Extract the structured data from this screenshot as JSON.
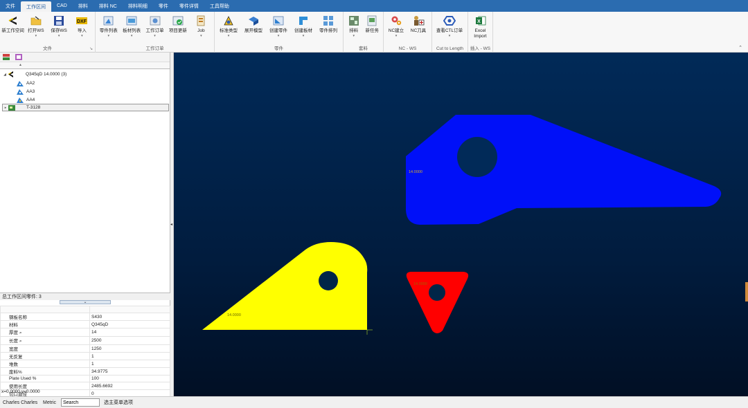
{
  "menu": {
    "tabs": [
      "文件",
      "工作区间",
      "CAD",
      "排料",
      "排料 NC",
      "排料明细",
      "零件",
      "零件详情",
      "工具帮助"
    ],
    "active_index": 1
  },
  "ribbon": {
    "groups": [
      {
        "name": "文件",
        "buttons": [
          {
            "label": "新工作空间",
            "icon": "new-workspace-icon",
            "dropdown": false
          },
          {
            "label": "打开WS",
            "icon": "open-folder-icon",
            "dropdown": true
          },
          {
            "label": "保存WS",
            "icon": "save-disk-icon",
            "dropdown": true
          },
          {
            "label": "导入",
            "icon": "dxf-import-icon",
            "dropdown": true
          }
        ]
      },
      {
        "name": "工作订单",
        "buttons": [
          {
            "label": "零件列表",
            "icon": "parts-list-icon",
            "dropdown": true
          },
          {
            "label": "板材列表",
            "icon": "plates-list-icon",
            "dropdown": true
          },
          {
            "label": "工作订单",
            "icon": "work-order-icon",
            "dropdown": true
          },
          {
            "label": "项目更新",
            "icon": "project-update-icon",
            "dropdown": false
          },
          {
            "label": "Job",
            "icon": "job-icon",
            "dropdown": true
          }
        ]
      },
      {
        "name": "零件",
        "buttons": [
          {
            "label": "标准类型",
            "icon": "standard-shape-icon",
            "dropdown": true
          },
          {
            "label": "展开模型",
            "icon": "unfold-model-icon",
            "dropdown": false
          },
          {
            "label": "创建零件",
            "icon": "create-part-icon",
            "dropdown": true
          },
          {
            "label": "创建板材",
            "icon": "create-plate-icon",
            "dropdown": true
          },
          {
            "label": "零件排列",
            "icon": "part-array-icon",
            "dropdown": false
          }
        ]
      },
      {
        "name": "套料",
        "buttons": [
          {
            "label": "排料",
            "icon": "nest-icon",
            "dropdown": true
          },
          {
            "label": "新任务",
            "icon": "new-task-icon",
            "dropdown": false
          }
        ]
      },
      {
        "name": "NC - WS",
        "buttons": [
          {
            "label": "NC建立",
            "icon": "nc-build-icon",
            "dropdown": true
          },
          {
            "label": "NC刀具",
            "icon": "nc-tool-icon",
            "dropdown": false
          }
        ]
      },
      {
        "name": "Cut to Length",
        "buttons": [
          {
            "label": "查看CTL订单",
            "icon": "ctl-order-icon",
            "dropdown": true
          }
        ]
      },
      {
        "name": "插入 - WS",
        "buttons": [
          {
            "label": "Excel Import",
            "icon": "excel-import-icon",
            "dropdown": false
          }
        ]
      }
    ],
    "colors": {
      "accent": "#2b6cb0"
    }
  },
  "tree": {
    "nodes": [
      {
        "label": "Q345qD 14.0000 (3)",
        "icon": "plate-group-icon",
        "level": 0,
        "expanded": true
      },
      {
        "label": "AA2",
        "icon": "part-icon",
        "level": 1
      },
      {
        "label": "AA3",
        "icon": "part-icon",
        "level": 1
      },
      {
        "label": "AA4",
        "icon": "part-icon",
        "level": 1
      },
      {
        "label": "T-3128",
        "icon": "nest-job-icon",
        "level": 0,
        "expanded": false,
        "selected": true
      }
    ]
  },
  "properties": {
    "title": "总工作区间零件: 3",
    "rows": [
      {
        "key": "钢板名称",
        "value": "S430"
      },
      {
        "key": "材料",
        "value": "Q345qD"
      },
      {
        "key": "厚度",
        "value": "14"
      },
      {
        "key": "长度",
        "value": "2500"
      },
      {
        "key": "宽度",
        "value": "1250"
      },
      {
        "key": "无反复",
        "value": "1"
      },
      {
        "key": "堆数",
        "value": "1"
      },
      {
        "key": "废料%",
        "value": "34.9775"
      },
      {
        "key": "Plate Used %",
        "value": "100"
      },
      {
        "key": "使用长度",
        "value": "2485.6692"
      },
      {
        "key": "切口直径",
        "value": "0"
      }
    ],
    "coords": "x=0.0000 y=0.0000"
  },
  "canvas": {
    "parts": [
      {
        "name": "blue-part",
        "label": "14.0000",
        "color": "#0010f8"
      },
      {
        "name": "yellow-part",
        "label": "14.0000",
        "color": "#ffff00"
      },
      {
        "name": "red-part",
        "label": "14.0000",
        "color": "#ff0000"
      }
    ],
    "background": "#011f45"
  },
  "statusbar": {
    "user": "Charles Charles",
    "unit": "Metric",
    "search_value": "Search",
    "hint": "选主菜单选项"
  }
}
